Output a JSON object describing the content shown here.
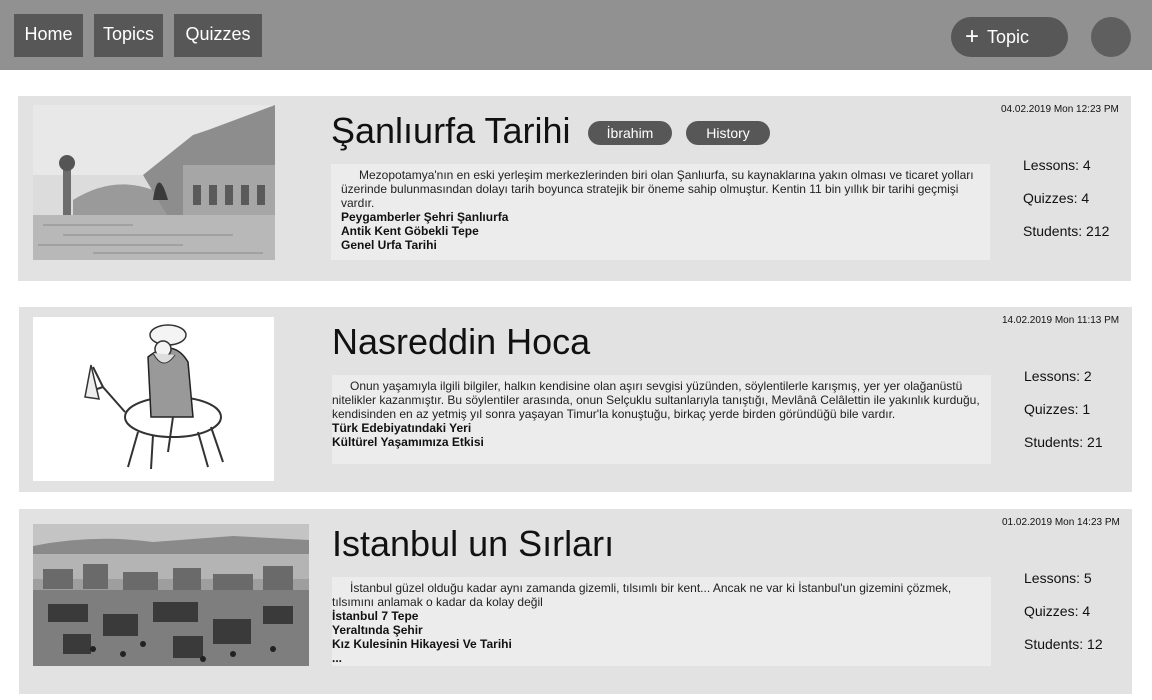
{
  "nav": {
    "home": "Home",
    "topics": "Topics",
    "quizzes": "Quizzes",
    "add_topic_icon": "+",
    "add_topic": "Topic"
  },
  "cards": [
    {
      "title": "Şanlıurfa Tarihi",
      "tags": [
        "İbrahim",
        "History"
      ],
      "date": "04.02.2019 Mon 12:23 PM",
      "description": "Mezopotamya'nın en eski yerleşim merkezlerinden biri olan Şanlıurfa, su kaynaklarına yakın olması ve ticaret yolları üzerinde bulunmasından dolayı tarih boyunca stratejik bir öneme sahip olmuştur. Kentin 11 bin yıllık bir tarihi geçmişi vardır.",
      "subtopics": [
        "Peygamberler Şehri Şanlıurfa",
        "Antik Kent Göbekli Tepe",
        "Genel Urfa Tarihi"
      ],
      "lessons": "Lessons: 4",
      "quizzes": "Quizzes: 4",
      "students": "Students: 212"
    },
    {
      "title": "Nasreddin Hoca",
      "date": "14.02.2019 Mon 11:13 PM",
      "description": "Onun yaşamıyla ilgili bilgiler, halkın kendisine olan aşırı sevgisi yüzünden, söylentilerle karışmış, yer yer olağanüstü nitelikler kazanmıştır. Bu söylentiler arasında, onun Selçuklu sultanlarıyla tanıştığı, Mevlânâ Celâlettin ile yakınlık kurduğu, kendisinden en az yetmiş yıl sonra yaşayan Timur'la konuştuğu, birkaç yerde birden göründüğü bile vardır.",
      "subtopics": [
        "Türk Edebiyatındaki Yeri",
        "Kültürel Yaşamımıza Etkisi"
      ],
      "lessons": "Lessons: 2",
      "quizzes": "Quizzes: 1",
      "students": "Students: 21"
    },
    {
      "title": "Istanbul un Sırları",
      "date": "01.02.2019 Mon 14:23 PM",
      "description": "İstanbul güzel olduğu kadar aynı zamanda gizemli, tılsımlı bir kent... Ancak ne var ki İstanbul'un gizemini çözmek, tılsımını anlamak o kadar da kolay değil",
      "subtopics": [
        "İstanbul 7 Tepe",
        "Yeraltında Şehir",
        "Kız Kulesinin Hikayesi Ve Tarihi",
        "..."
      ],
      "lessons": "Lessons: 5",
      "quizzes": "Quizzes: 4",
      "students": "Students: 12"
    }
  ]
}
